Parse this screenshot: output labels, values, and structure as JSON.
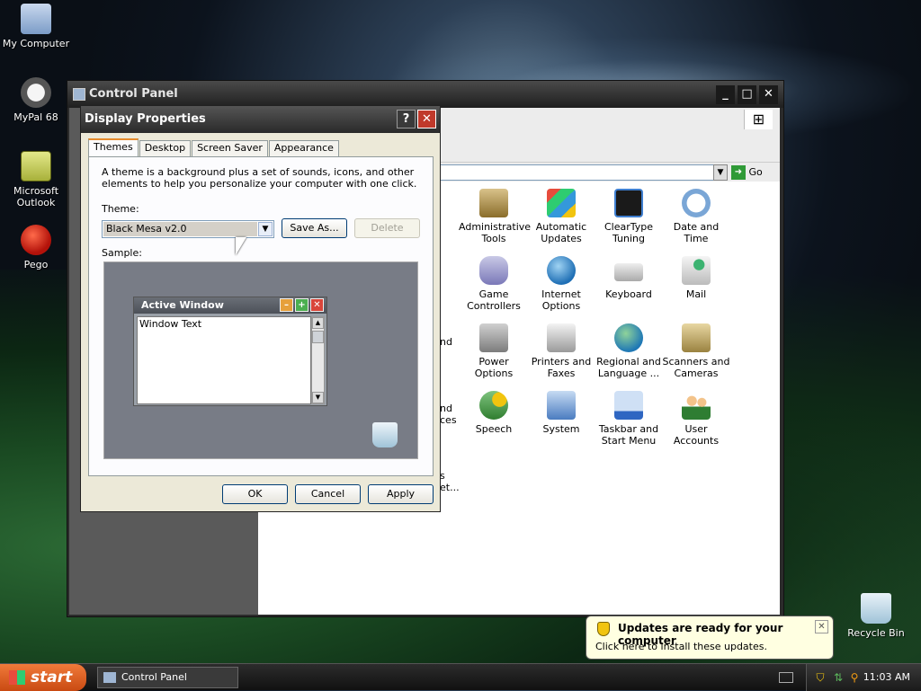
{
  "desktop": {
    "icons": [
      {
        "label": "My Computer"
      },
      {
        "label": "MyPal 68"
      },
      {
        "label": "Microsoft Outlook"
      },
      {
        "label": "Pego"
      },
      {
        "label": "Recycle Bin"
      }
    ]
  },
  "control_panel": {
    "title": "Control Panel",
    "go_label": "Go",
    "items": [
      {
        "label": "Administrative Tools"
      },
      {
        "label": "Automatic Updates"
      },
      {
        "label": "ClearType Tuning"
      },
      {
        "label": "Date and Time"
      },
      {
        "label": "Game Controllers"
      },
      {
        "label": "Internet Options"
      },
      {
        "label": "Keyboard"
      },
      {
        "label": "Mail"
      },
      {
        "label": "Power Options"
      },
      {
        "label": "Printers and Faxes"
      },
      {
        "label": "Regional and Language ..."
      },
      {
        "label": "Scanners and Cameras"
      },
      {
        "label": "Speech"
      },
      {
        "label": "System"
      },
      {
        "label": "Taskbar and Start Menu"
      },
      {
        "label": "User Accounts"
      }
    ],
    "partial_labels": [
      "nd",
      "nd",
      "ces",
      "s",
      "et..."
    ]
  },
  "display_properties": {
    "title": "Display Properties",
    "help_label": "?",
    "tabs": [
      "Themes",
      "Desktop",
      "Screen Saver",
      "Appearance"
    ],
    "description": "A theme is a background plus a set of sounds, icons, and other elements to help you personalize your computer with one click.",
    "theme_label": "Theme:",
    "theme_value": "Black Mesa v2.0",
    "save_as_label": "Save As...",
    "delete_label": "Delete",
    "sample_label": "Sample:",
    "sample_window_title": "Active Window",
    "sample_window_text": "Window Text",
    "ok_label": "OK",
    "cancel_label": "Cancel",
    "apply_label": "Apply"
  },
  "notification": {
    "title": "Updates are ready for your computer",
    "body": "Click here to install these updates."
  },
  "taskbar": {
    "start_label": "start",
    "task_label": "Control Panel",
    "clock": "11:03 AM"
  }
}
